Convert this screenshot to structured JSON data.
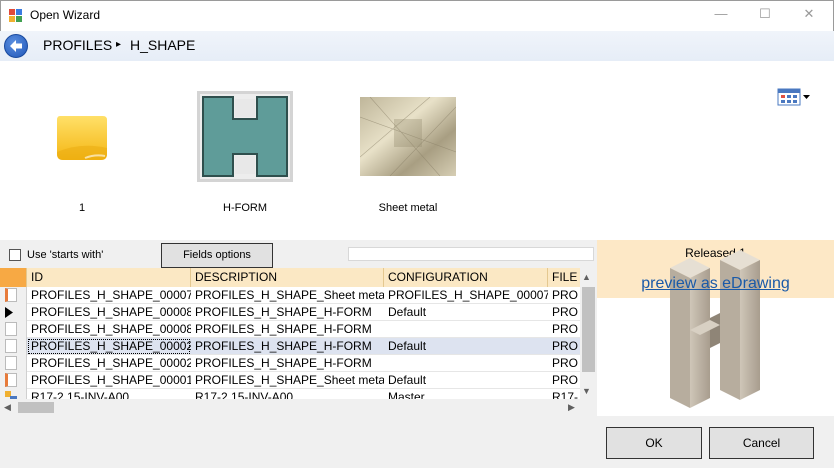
{
  "window": {
    "title": "Open Wizard",
    "minimize_glyph": "—",
    "maximize_glyph": "☐",
    "close_glyph": "✕"
  },
  "breadcrumb": {
    "items": [
      "PROFILES",
      "H_SHAPE"
    ],
    "separator": "▸"
  },
  "tiles": [
    {
      "label": "1",
      "icon": "folder-icon"
    },
    {
      "label": "H-FORM",
      "icon": "h-form-thumbnail"
    },
    {
      "label": "Sheet metal",
      "icon": "sheet-metal-thumbnail"
    }
  ],
  "filter": {
    "use_starts_with_label": "Use 'starts with'",
    "use_starts_with_checked": false,
    "fields_options_label": "Fields options",
    "search_value": ""
  },
  "grid": {
    "columns": [
      "ID",
      "DESCRIPTION",
      "CONFIGURATION",
      "FILE"
    ],
    "rows": [
      {
        "id": "PROFILES_H_SHAPE_00007",
        "description": "PROFILES_H_SHAPE_Sheet metal",
        "configuration": "PROFILES_H_SHAPE_00007",
        "file": "PRO"
      },
      {
        "id": "PROFILES_H_SHAPE_00008",
        "description": "PROFILES_H_SHAPE_H-FORM",
        "configuration": "Default",
        "file": "PRO"
      },
      {
        "id": "PROFILES_H_SHAPE_00008",
        "description": "PROFILES_H_SHAPE_H-FORM",
        "configuration": "",
        "file": "PRO"
      },
      {
        "id": "PROFILES_H_SHAPE_00002",
        "description": "PROFILES_H_SHAPE_H-FORM",
        "configuration": "Default",
        "file": "PRO"
      },
      {
        "id": "PROFILES_H_SHAPE_00002",
        "description": "PROFILES_H_SHAPE_H-FORM",
        "configuration": "",
        "file": "PRO"
      },
      {
        "id": "PROFILES_H_SHAPE_00001",
        "description": "PROFILES_H_SHAPE_Sheet metal",
        "configuration": "Default",
        "file": "PRO"
      },
      {
        "id": "R17-2 15-INV-A00",
        "description": "R17-2 15-INV-A00",
        "configuration": "Master",
        "file": "R17-"
      }
    ]
  },
  "preview": {
    "status": "Released 1",
    "link_label": "preview as eDrawing"
  },
  "buttons": {
    "ok": "OK",
    "cancel": "Cancel"
  }
}
